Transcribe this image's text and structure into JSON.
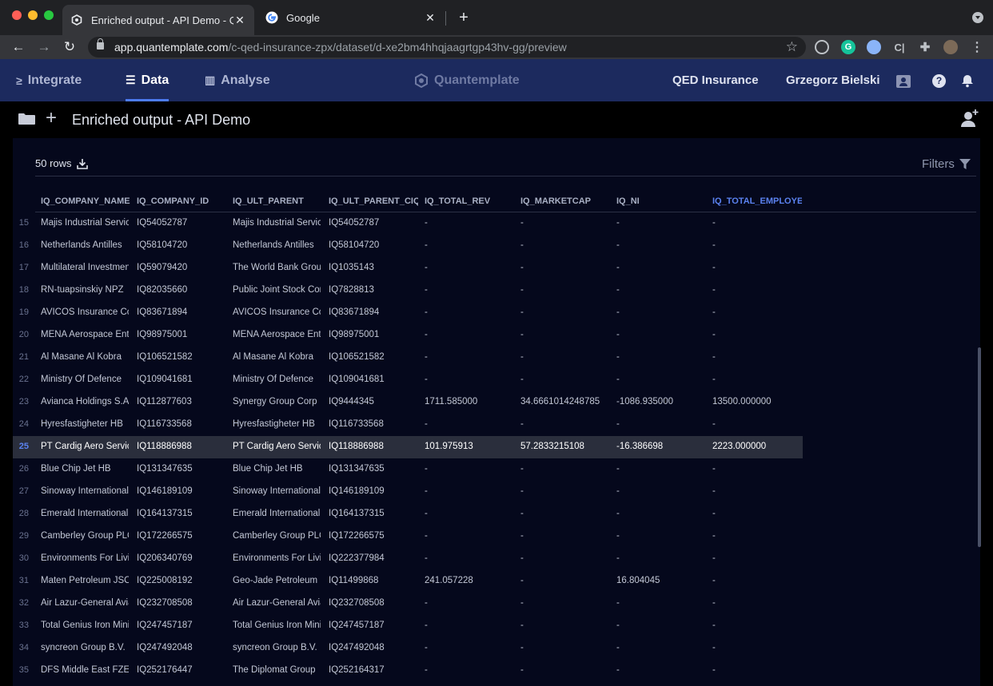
{
  "browser": {
    "tabs": [
      {
        "title": "Enriched output - API Demo - Quantemplate",
        "active": true
      },
      {
        "title": "Google",
        "active": false
      }
    ],
    "url_host": "app.quantemplate.com",
    "url_path": "/c-qed-insurance-zpx/dataset/d-xe2bm4hhqjaagrtgp43hv-gg/preview"
  },
  "app": {
    "nav": {
      "integrate": "Integrate",
      "data": "Data",
      "analyse": "Analyse"
    },
    "brand": "Quantemplate",
    "org": "QED Insurance",
    "user": "Grzegorz Bielski"
  },
  "dataset": {
    "title": "Enriched output - API Demo",
    "row_count": "50 rows",
    "filters_label": "Filters"
  },
  "table": {
    "columns": [
      "IQ_COMPANY_NAME",
      "IQ_COMPANY_ID",
      "IQ_ULT_PARENT",
      "IQ_ULT_PARENT_CIQ_ID",
      "IQ_TOTAL_REV",
      "IQ_MARKETCAP",
      "IQ_NI",
      "IQ_TOTAL_EMPLOYEES"
    ],
    "rows": [
      {
        "n": "15",
        "c": [
          "Majis Industrial Services",
          "IQ54052787",
          "Majis Industrial Services",
          "IQ54052787",
          "-",
          "-",
          "-",
          "-"
        ]
      },
      {
        "n": "16",
        "c": [
          "Netherlands Antilles",
          "IQ58104720",
          "Netherlands Antilles",
          "IQ58104720",
          "-",
          "-",
          "-",
          "-"
        ]
      },
      {
        "n": "17",
        "c": [
          "Multilateral Investment",
          "IQ59079420",
          "The World Bank Group",
          "IQ1035143",
          "-",
          "-",
          "-",
          "-"
        ]
      },
      {
        "n": "18",
        "c": [
          "RN-tuapsinskiy NPZ",
          "IQ82035660",
          "Public Joint Stock Company",
          "IQ7828813",
          "-",
          "-",
          "-",
          "-"
        ]
      },
      {
        "n": "19",
        "c": [
          "AVICOS Insurance Company",
          "IQ83671894",
          "AVICOS Insurance Company",
          "IQ83671894",
          "-",
          "-",
          "-",
          "-"
        ]
      },
      {
        "n": "20",
        "c": [
          "MENA Aerospace Enterprises",
          "IQ98975001",
          "MENA Aerospace Enterprises",
          "IQ98975001",
          "-",
          "-",
          "-",
          "-"
        ]
      },
      {
        "n": "21",
        "c": [
          "Al Masane Al Kobra",
          "IQ106521582",
          "Al Masane Al Kobra",
          "IQ106521582",
          "-",
          "-",
          "-",
          "-"
        ]
      },
      {
        "n": "22",
        "c": [
          "Ministry Of Defence",
          "IQ109041681",
          "Ministry Of Defence",
          "IQ109041681",
          "-",
          "-",
          "-",
          "-"
        ]
      },
      {
        "n": "23",
        "c": [
          "Avianca Holdings S.A.",
          "IQ112877603",
          "Synergy Group Corp",
          "IQ9444345",
          "1711.585000",
          "34.6661014248785",
          "-1086.935000",
          "13500.000000"
        ]
      },
      {
        "n": "24",
        "c": [
          "Hyresfastigheter HB",
          "IQ116733568",
          "Hyresfastigheter HB",
          "IQ116733568",
          "-",
          "-",
          "-",
          "-"
        ]
      },
      {
        "n": "25",
        "c": [
          "PT Cardig Aero Services",
          "IQ118886988",
          "PT Cardig Aero Services",
          "IQ118886988",
          "101.975913",
          "57.2833215108",
          "-16.386698",
          "2223.000000"
        ],
        "selected": true
      },
      {
        "n": "26",
        "c": [
          "Blue Chip Jet HB",
          "IQ131347635",
          "Blue Chip Jet HB",
          "IQ131347635",
          "-",
          "-",
          "-",
          "-"
        ]
      },
      {
        "n": "27",
        "c": [
          "Sinoway International",
          "IQ146189109",
          "Sinoway International",
          "IQ146189109",
          "-",
          "-",
          "-",
          "-"
        ]
      },
      {
        "n": "28",
        "c": [
          "Emerald International",
          "IQ164137315",
          "Emerald International",
          "IQ164137315",
          "-",
          "-",
          "-",
          "-"
        ]
      },
      {
        "n": "29",
        "c": [
          "Camberley Group PLC",
          "IQ172266575",
          "Camberley Group PLC",
          "IQ172266575",
          "-",
          "-",
          "-",
          "-"
        ]
      },
      {
        "n": "30",
        "c": [
          "Environments For Living",
          "IQ206340769",
          "Environments For Living",
          "IQ222377984",
          "-",
          "-",
          "-",
          "-"
        ]
      },
      {
        "n": "31",
        "c": [
          "Maten Petroleum JSC",
          "IQ225008192",
          "Geo-Jade Petroleum",
          "IQ11499868",
          "241.057228",
          "-",
          "16.804045",
          "-"
        ]
      },
      {
        "n": "32",
        "c": [
          "Air Lazur-General Aviation",
          "IQ232708508",
          "Air Lazur-General Aviation",
          "IQ232708508",
          "-",
          "-",
          "-",
          "-"
        ]
      },
      {
        "n": "33",
        "c": [
          "Total Genius Iron Mining",
          "IQ247457187",
          "Total Genius Iron Mining",
          "IQ247457187",
          "-",
          "-",
          "-",
          "-"
        ]
      },
      {
        "n": "34",
        "c": [
          "syncreon Group B.V.",
          "IQ247492048",
          "syncreon Group B.V.",
          "IQ247492048",
          "-",
          "-",
          "-",
          "-"
        ]
      },
      {
        "n": "35",
        "c": [
          "DFS Middle East FZE",
          "IQ252176447",
          "The Diplomat Group",
          "IQ252164317",
          "-",
          "-",
          "-",
          "-"
        ]
      }
    ]
  }
}
